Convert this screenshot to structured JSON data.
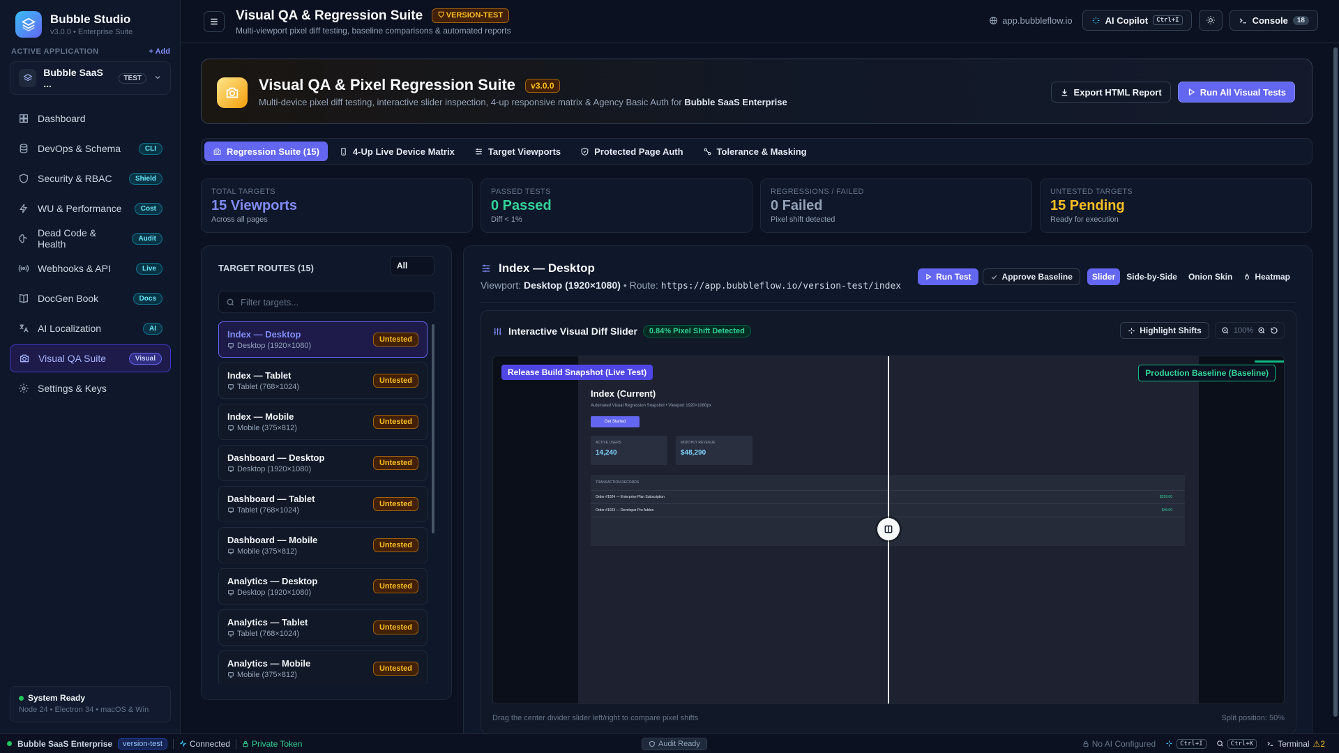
{
  "sidebar": {
    "brand_title": "Bubble Studio",
    "brand_sub": "v3.0.0 • Enterprise Suite",
    "section_label": "ACTIVE APPLICATION",
    "add_label": "+ Add",
    "app_name": "Bubble SaaS ...",
    "app_tag": "TEST",
    "items": [
      {
        "label": "Dashboard",
        "badge": "",
        "icon": "dashboard-icon"
      },
      {
        "label": "DevOps & Schema",
        "badge": "CLI",
        "icon": "database-icon"
      },
      {
        "label": "Security & RBAC",
        "badge": "Shield",
        "icon": "shield-icon"
      },
      {
        "label": "WU & Performance",
        "badge": "Cost",
        "icon": "lightning-icon"
      },
      {
        "label": "Dead Code & Health",
        "badge": "Audit",
        "icon": "brain-icon"
      },
      {
        "label": "Webhooks & API",
        "badge": "Live",
        "icon": "broadcast-icon"
      },
      {
        "label": "DocGen Book",
        "badge": "Docs",
        "icon": "book-icon"
      },
      {
        "label": "AI Localization",
        "badge": "AI",
        "icon": "translate-icon"
      },
      {
        "label": "Visual QA Suite",
        "badge": "Visual",
        "icon": "camera-icon",
        "active": true
      },
      {
        "label": "Settings & Keys",
        "badge": "",
        "icon": "gear-icon"
      }
    ],
    "system_title": "System Ready",
    "system_sub": "Node 24 • Electron 34 • macOS & Win"
  },
  "topbar": {
    "title": "Visual QA & Regression Suite",
    "version_tag": "VERSION-TEST",
    "subtitle": "Multi-viewport pixel diff testing, baseline comparisons & automated reports",
    "url": "app.bubbleflow.io",
    "copilot_label": "AI Copilot",
    "copilot_kbd": "Ctrl+I",
    "console_label": "Console",
    "console_count": "18"
  },
  "hero": {
    "title": "Visual QA & Pixel Regression Suite",
    "version": "v3.0.0",
    "subtitle_pre": "Multi-device pixel diff testing, interactive slider inspection, 4-up responsive matrix & Agency Basic Auth for ",
    "subtitle_bold": "Bubble SaaS Enterprise",
    "export_label": "Export HTML Report",
    "run_all_label": "Run All Visual Tests"
  },
  "tabs": [
    {
      "label": "Regression Suite (15)",
      "active": true
    },
    {
      "label": "4-Up Live Device Matrix"
    },
    {
      "label": "Target Viewports"
    },
    {
      "label": "Protected Page Auth"
    },
    {
      "label": "Tolerance & Masking"
    }
  ],
  "stats": [
    {
      "label": "TOTAL TARGETS",
      "value": "15 Viewports",
      "sub": "Across all pages",
      "color": "#818cf8"
    },
    {
      "label": "PASSED TESTS",
      "value": "0 Passed",
      "sub": "Diff < 1%",
      "color": "#34d399"
    },
    {
      "label": "REGRESSIONS / FAILED",
      "value": "0 Failed",
      "sub": "Pixel shift detected",
      "color": "#94a3b8"
    },
    {
      "label": "UNTESTED TARGETS",
      "value": "15 Pending",
      "sub": "Ready for execution",
      "color": "#fbbf24"
    }
  ],
  "routes": {
    "header": "TARGET ROUTES (15)",
    "filter_value": "All",
    "search_placeholder": "Filter targets...",
    "status_label": "Untested",
    "items": [
      {
        "name": "Index — Desktop",
        "device": "Desktop (1920×1080)",
        "active": true
      },
      {
        "name": "Index — Tablet",
        "device": "Tablet (768×1024)"
      },
      {
        "name": "Index — Mobile",
        "device": "Mobile (375×812)"
      },
      {
        "name": "Dashboard — Desktop",
        "device": "Desktop (1920×1080)"
      },
      {
        "name": "Dashboard — Tablet",
        "device": "Tablet (768×1024)"
      },
      {
        "name": "Dashboard — Mobile",
        "device": "Mobile (375×812)"
      },
      {
        "name": "Analytics — Desktop",
        "device": "Desktop (1920×1080)"
      },
      {
        "name": "Analytics — Tablet",
        "device": "Tablet (768×1024)"
      },
      {
        "name": "Analytics — Mobile",
        "device": "Mobile (375×812)"
      }
    ]
  },
  "detail": {
    "title": "Index — Desktop",
    "viewport_label": "Viewport:",
    "viewport_value": "Desktop (1920×1080)",
    "route_label": "• Route:",
    "route_value": "https://app.bubbleflow.io/version-test/index",
    "run_label": "Run Test",
    "approve_label": "Approve Baseline",
    "modes": [
      "Slider",
      "Side-by-Side",
      "Onion Skin",
      "Heatmap"
    ],
    "active_mode": "Slider"
  },
  "diff": {
    "title": "Interactive Visual Diff Slider",
    "shift_badge": "0.84% Pixel Shift Detected",
    "highlight_label": "Highlight Shifts",
    "zoom": "100%",
    "live_label": "Release Build Snapshot (Live Test)",
    "baseline_label": "Production Baseline (Baseline)",
    "split_position_pct": 50,
    "footer_hint": "Drag the center divider slider left/right to compare pixel shifts",
    "footer_split": "Split position: 50%",
    "snapshot": {
      "title": "Index (Current)",
      "subtitle": "Automated Visual Regression Snapshot • Viewport 1920×1080px",
      "button": "Get Started",
      "cards": [
        {
          "label": "ACTIVE USERS",
          "value": "14,240"
        },
        {
          "label": "MONTHLY REVENUE",
          "value": "$48,290"
        }
      ],
      "table_header": "TRANSACTION RECORDS",
      "rows": [
        {
          "label": "Order #1024 — Enterprise Plan Subscription",
          "amount": "$299.00"
        },
        {
          "label": "Order #1023 — Developer Pro Addon",
          "amount": "$49.00"
        }
      ]
    }
  },
  "statusbar": {
    "app": "Bubble SaaS Enterprise",
    "env": "version-test",
    "connected": "Connected",
    "token": "Private Token",
    "audit": "Audit Ready",
    "ai": "No AI Configured",
    "kbd1": "Ctrl+I",
    "kbd2": "Ctrl+K",
    "terminal": "Terminal",
    "warnings": "2"
  }
}
